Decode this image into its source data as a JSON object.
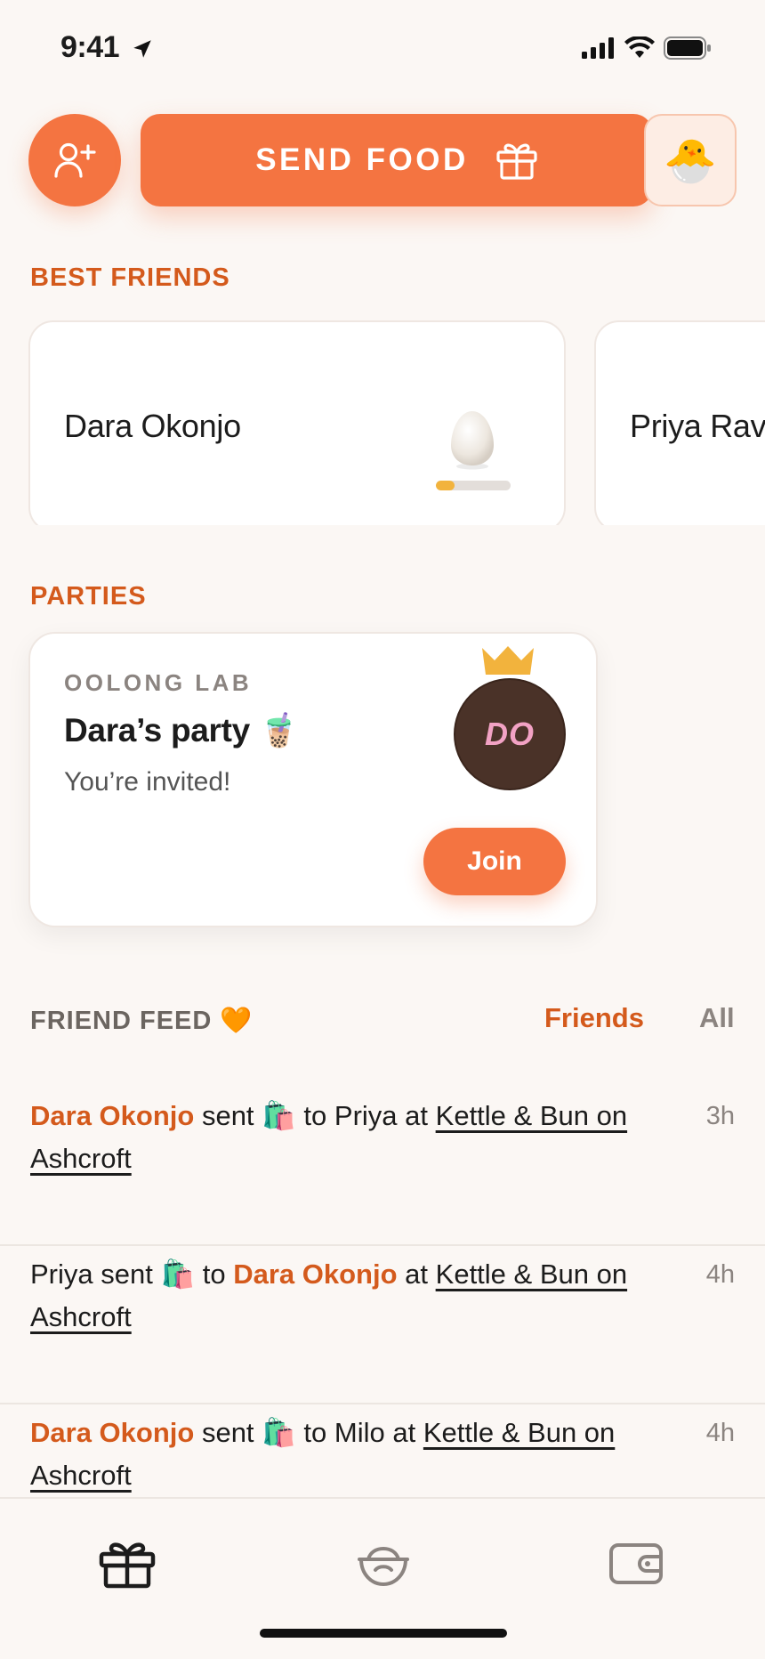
{
  "status_bar": {
    "time": "9:41"
  },
  "top_actions": {
    "send_food_label": "SEND FOOD",
    "avatar_emoji": "🐣"
  },
  "best_friends": {
    "title": "BEST FRIENDS",
    "items": [
      {
        "name": "Dara Okonjo",
        "progress": 0.25
      },
      {
        "name": "Priya Ravi"
      }
    ]
  },
  "parties": {
    "title": "PARTIES",
    "card": {
      "venue": "OOLONG LAB",
      "title": "Dara’s party 🧋",
      "subtitle": "You’re invited!",
      "host_initials": "DO",
      "join_label": "Join"
    }
  },
  "friend_feed": {
    "title": "FRIEND FEED 🧡",
    "tabs": {
      "friends": "Friends",
      "all": "All"
    },
    "items": [
      {
        "a": "Dara Okonjo",
        "a_hl": true,
        "verb": "sent",
        "gift": "🛍️",
        "to": "to",
        "b": "Priya",
        "b_hl": false,
        "at": "at",
        "venue": "Kettle & Bun on Ashcroft",
        "time": "3h"
      },
      {
        "a": "Priya",
        "a_hl": false,
        "verb": "sent",
        "gift": "🛍️",
        "to": "to",
        "b": "Dara Okonjo",
        "b_hl": true,
        "at": "at",
        "venue": "Kettle & Bun on Ashcroft",
        "time": "4h"
      },
      {
        "a": "Dara Okonjo",
        "a_hl": true,
        "verb": "sent",
        "gift": "🛍️",
        "to": "to",
        "b": "Milo",
        "b_hl": false,
        "at": "at",
        "venue": "Kettle & Bun on Ashcroft",
        "time": "4h"
      }
    ]
  },
  "icons": {
    "add_friend": "user-plus-icon",
    "gift": "gift-icon",
    "bowl": "bowl-icon",
    "wallet": "wallet-icon"
  },
  "colors": {
    "accent": "#F47441",
    "accent_text": "#D45A1C",
    "background": "#FBF7F4",
    "progress": "#F2B33D",
    "crown": "#F2B33D",
    "host_avatar": "#4A3228"
  }
}
